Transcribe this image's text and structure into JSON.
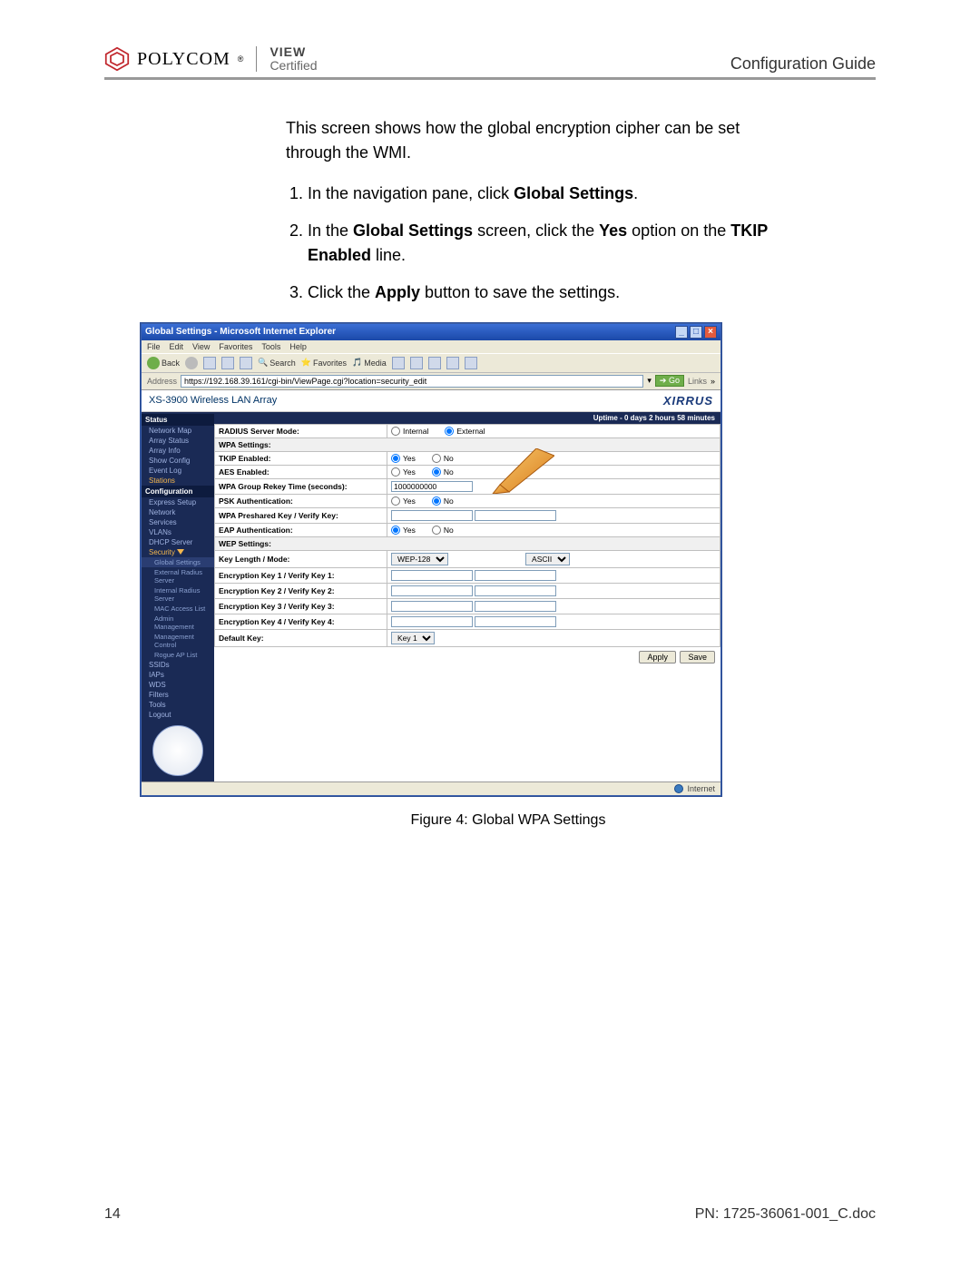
{
  "header": {
    "brand_name": "POLYCOM",
    "brand_sub_top": "VIEW",
    "brand_sub_bottom": "Certified",
    "doc_title": "Configuration Guide"
  },
  "intro_text": "This screen shows how the global encryption cipher can be set through the WMI.",
  "steps": [
    {
      "pre": "In the navigation pane, click ",
      "bold": "Global Settings",
      "post": "."
    },
    {
      "pre": "In the ",
      "bold": "Global Settings",
      "mid": " screen, click the ",
      "bold2": "Yes",
      "mid2": " option on the ",
      "bold3": "TKIP Enabled",
      "post": " line."
    },
    {
      "pre": "Click the ",
      "bold": "Apply",
      "post": " button to save the settings."
    }
  ],
  "ie": {
    "title": "Global Settings - Microsoft Internet Explorer",
    "menus": [
      "File",
      "Edit",
      "View",
      "Favorites",
      "Tools",
      "Help"
    ],
    "back_label": "Back",
    "search_label": "Search",
    "favorites_label": "Favorites",
    "media_label": "Media",
    "address_label": "Address",
    "address_value": "https://192.168.39.161/cgi-bin/ViewPage.cgi?location=security_edit",
    "go_label": "Go",
    "links_label": "Links",
    "status_text": "Internet"
  },
  "app": {
    "product_name": "XS-3900 Wireless LAN Array",
    "vendor_logo_text": "XIRRUS",
    "uptime": "Uptime - 0 days 2 hours 58 minutes",
    "sidebar": {
      "status_header": "Status",
      "status_items": [
        "Network Map",
        "Array Status",
        "Array Info",
        "Show Config",
        "Event Log",
        "Stations"
      ],
      "config_header": "Configuration",
      "config_items": [
        "Express Setup",
        "Network",
        "Services",
        "VLANs",
        "DHCP Server",
        "Security"
      ],
      "security_sub": [
        "Global Settings",
        "External Radius Server",
        "Internal Radius Server",
        "MAC Access List",
        "Admin Management",
        "Management Control",
        "Rogue AP List"
      ],
      "rest_items": [
        "SSIDs",
        "IAPs",
        "WDS",
        "Filters",
        "Tools",
        "Logout"
      ]
    },
    "rows": {
      "radius_mode": "RADIUS Server Mode:",
      "wpa_header": "WPA Settings:",
      "tkip": "TKIP Enabled:",
      "aes": "AES Enabled:",
      "rekey": "WPA Group Rekey Time (seconds):",
      "rekey_val": "1000000000",
      "psk": "PSK Authentication:",
      "preshared": "WPA Preshared Key / Verify Key:",
      "eap": "EAP Authentication:",
      "wep_header": "WEP Settings:",
      "keylen": "Key Length / Mode:",
      "keylen_sel": "WEP-128",
      "keymode_sel": "ASCII",
      "ek1": "Encryption Key 1 / Verify Key 1:",
      "ek2": "Encryption Key 2 / Verify Key 2:",
      "ek3": "Encryption Key 3 / Verify Key 3:",
      "ek4": "Encryption Key 4 / Verify Key 4:",
      "defkey": "Default Key:",
      "defkey_sel": "Key 1"
    },
    "opts": {
      "internal": "Internal",
      "external": "External",
      "yes": "Yes",
      "no": "No"
    },
    "buttons": {
      "apply": "Apply",
      "save": "Save"
    }
  },
  "figure_caption": "Figure 4: Global WPA Settings",
  "footer": {
    "page": "14",
    "docid": "PN: 1725-36061-001_C.doc"
  }
}
